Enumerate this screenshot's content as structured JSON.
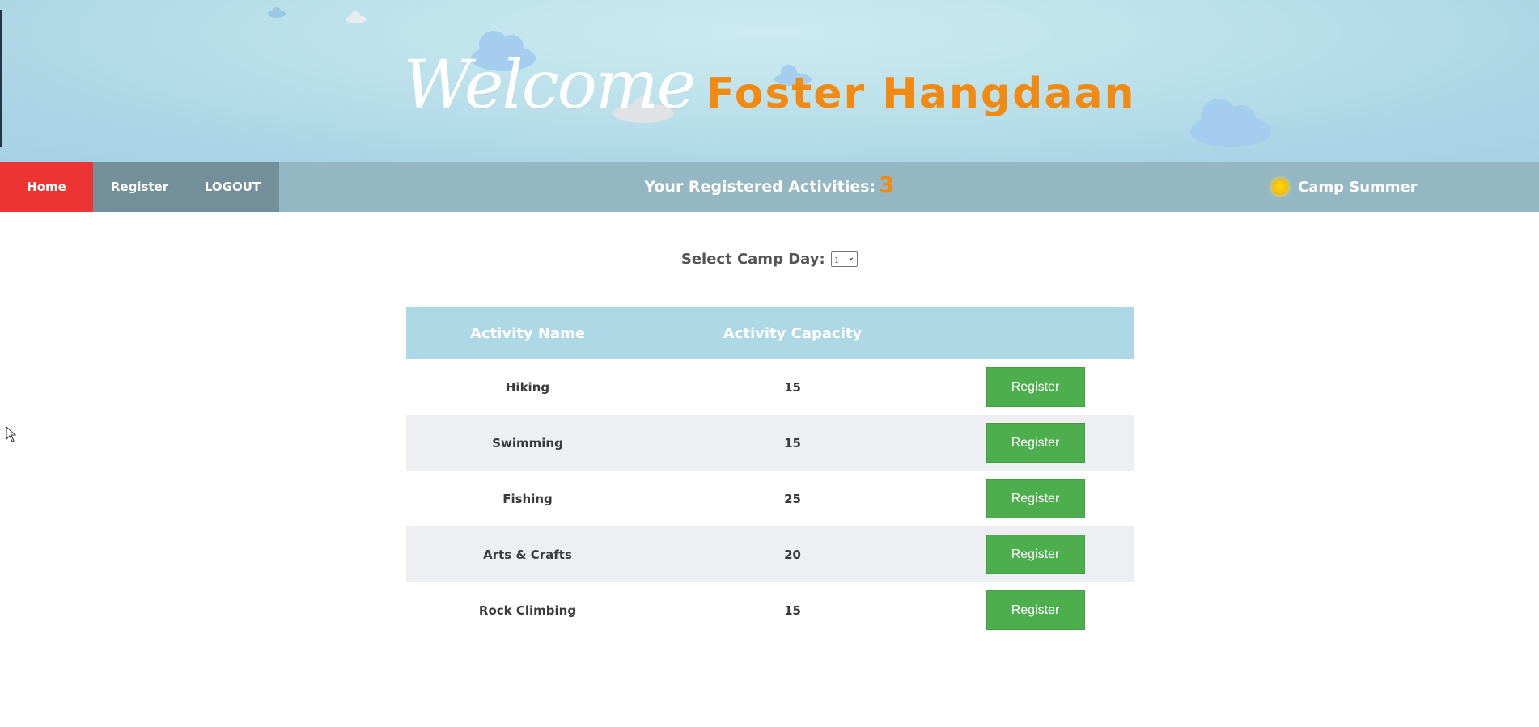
{
  "hero": {
    "welcome_word": "Welcome",
    "user_name": "Foster Hangdaan",
    "name_color": "#f28a12"
  },
  "nav": {
    "home_label": "Home",
    "register_label": "Register",
    "logout_label": "LOGOUT",
    "active_item": "Home",
    "active_color": "#ed3434"
  },
  "registered": {
    "label": "Your Registered Activities:",
    "count": "3"
  },
  "brand": {
    "icon": "sun-icon",
    "label": "Camp Summer"
  },
  "camp_day": {
    "label": "Select Camp Day:",
    "selected": "1"
  },
  "table": {
    "headers": {
      "name": "Activity Name",
      "capacity": "Activity Capacity",
      "action": ""
    },
    "header_color": "#add8e6",
    "button_color": "#4cae4c",
    "rows": [
      {
        "name": "Hiking",
        "capacity": "15",
        "button": "Register"
      },
      {
        "name": "Swimming",
        "capacity": "15",
        "button": "Register"
      },
      {
        "name": "Fishing",
        "capacity": "25",
        "button": "Register"
      },
      {
        "name": "Arts & Crafts",
        "capacity": "20",
        "button": "Register"
      },
      {
        "name": "Rock Climbing",
        "capacity": "15",
        "button": "Register"
      }
    ]
  }
}
